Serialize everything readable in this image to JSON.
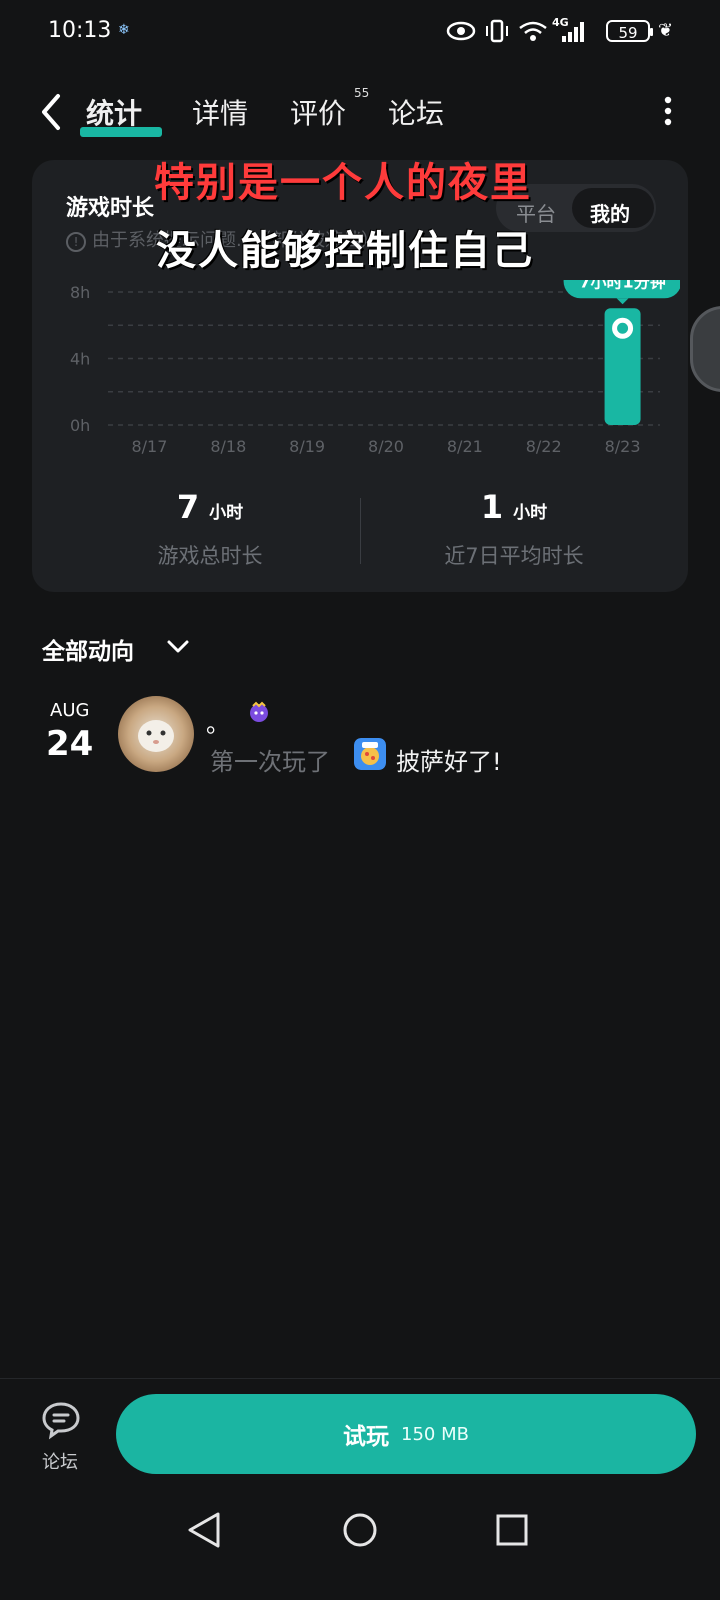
{
  "status_bar": {
    "time": "10:13",
    "network": "4G",
    "battery": "59"
  },
  "nav": {
    "tabs": [
      {
        "label": "统计",
        "active": true
      },
      {
        "label": "详情",
        "active": false
      },
      {
        "label": "评价",
        "active": false
      },
      {
        "label": "论坛",
        "active": false
      }
    ],
    "review_badge": "55"
  },
  "stats_card": {
    "title": "游戏时长",
    "notice": "由于系统提示问题...（部分被遮挡）",
    "segment": {
      "platform": "平台",
      "mine": "我的"
    },
    "tooltip": "7小时1分钟",
    "accent_color": "#19b7a3"
  },
  "overlay_captions": {
    "line1": "特别是一个人的夜里",
    "line2": "没人能够控制住自己"
  },
  "chart_data": {
    "type": "bar",
    "categories": [
      "8/17",
      "8/18",
      "8/19",
      "8/20",
      "8/21",
      "8/22",
      "8/23"
    ],
    "values": [
      0,
      0,
      0,
      0,
      0,
      0,
      7.02
    ],
    "y_ticks": [
      "0h",
      "4h",
      "8h"
    ],
    "ylim": [
      0,
      8
    ],
    "unit": "hours",
    "grid": true,
    "bar_color": "#19b7a3",
    "highlight_label": "7小时1分钟"
  },
  "summary": {
    "total": {
      "value": "7",
      "unit": "小时",
      "label": "游戏总时长"
    },
    "avg": {
      "value": "1",
      "unit": "小时",
      "label": "近7日平均时长"
    }
  },
  "activity": {
    "filter_label": "全部动向",
    "items": [
      {
        "month": "AUG",
        "day": "24",
        "username": "。",
        "text_prefix": "第一次玩了",
        "game_name": "披萨好了!"
      }
    ]
  },
  "bottom": {
    "forum_label": "论坛",
    "play_label": "试玩",
    "play_size": "150 MB"
  }
}
